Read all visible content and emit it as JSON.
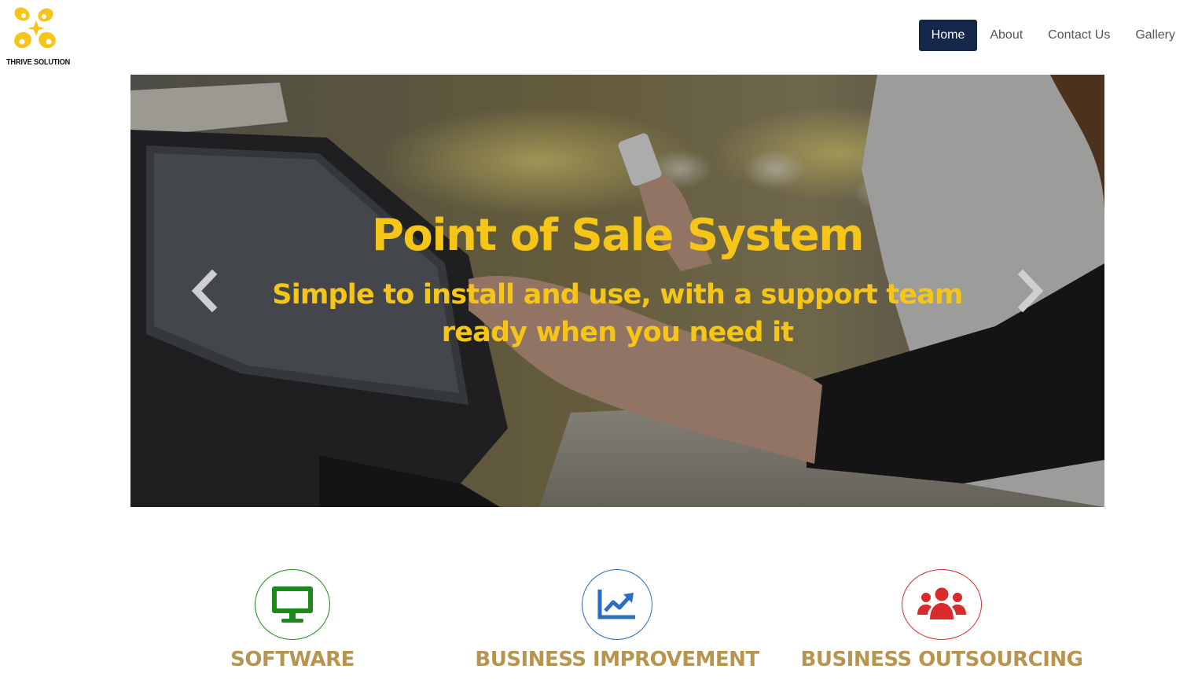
{
  "brand": {
    "name": "THRIVE SOLUTION",
    "logo_color": "#f5c518"
  },
  "nav": {
    "items": [
      {
        "label": "Home",
        "active": true
      },
      {
        "label": "About",
        "active": false
      },
      {
        "label": "Contact Us",
        "active": false
      },
      {
        "label": "Gallery",
        "active": false
      }
    ],
    "active_color": "#14284b"
  },
  "hero": {
    "title": "Point of Sale System",
    "subtitle": "Simple to install and use, with a support team ready when you need it",
    "text_color": "#f5c518",
    "prev_icon": "chevron-left-icon",
    "next_icon": "chevron-right-icon"
  },
  "features": [
    {
      "title": "SOFTWARE",
      "icon": "monitor-icon",
      "color": "#1a8a1a"
    },
    {
      "title": "BUSINESS IMPROVEMENT",
      "icon": "chart-line-icon",
      "color": "#2a6fc0"
    },
    {
      "title": "BUSINESS OUTSOURCING",
      "icon": "users-icon",
      "color": "#d92b2b"
    }
  ],
  "feature_title_color": "#b8954e"
}
